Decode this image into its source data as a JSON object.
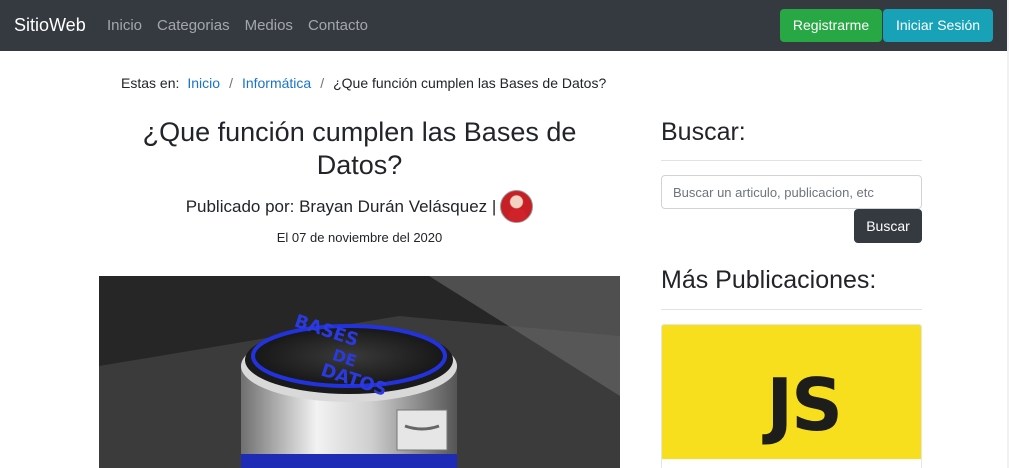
{
  "navbar": {
    "brand": "SitioWeb",
    "links": [
      "Inicio",
      "Categorias",
      "Medios",
      "Contacto"
    ],
    "register_label": "Registrarme",
    "login_label": "Iniciar Sesión"
  },
  "breadcrumb": {
    "label": "Estas en:",
    "items": [
      "Inicio",
      "Informática",
      "¿Que función cumplen las Bases de Datos?"
    ]
  },
  "article": {
    "title": "¿Que función cumplen las Bases de Datos?",
    "byline": "Publicado por: Brayan Durán Velásquez |",
    "date": "El 07 de noviembre del 2020",
    "image_text": [
      "BASES",
      "DE",
      "DATOS"
    ]
  },
  "sidebar": {
    "search_heading": "Buscar:",
    "search_placeholder": "Buscar un articulo, publicacion, etc",
    "search_button": "Buscar",
    "more_heading": "Más Publicaciones:",
    "card_image_text": "JS"
  },
  "colors": {
    "navbar_bg": "#343a40",
    "register_green": "#28a745",
    "login_cyan": "#17a2b8",
    "link_blue": "#1a73c8",
    "js_yellow": "#f7df1e"
  }
}
